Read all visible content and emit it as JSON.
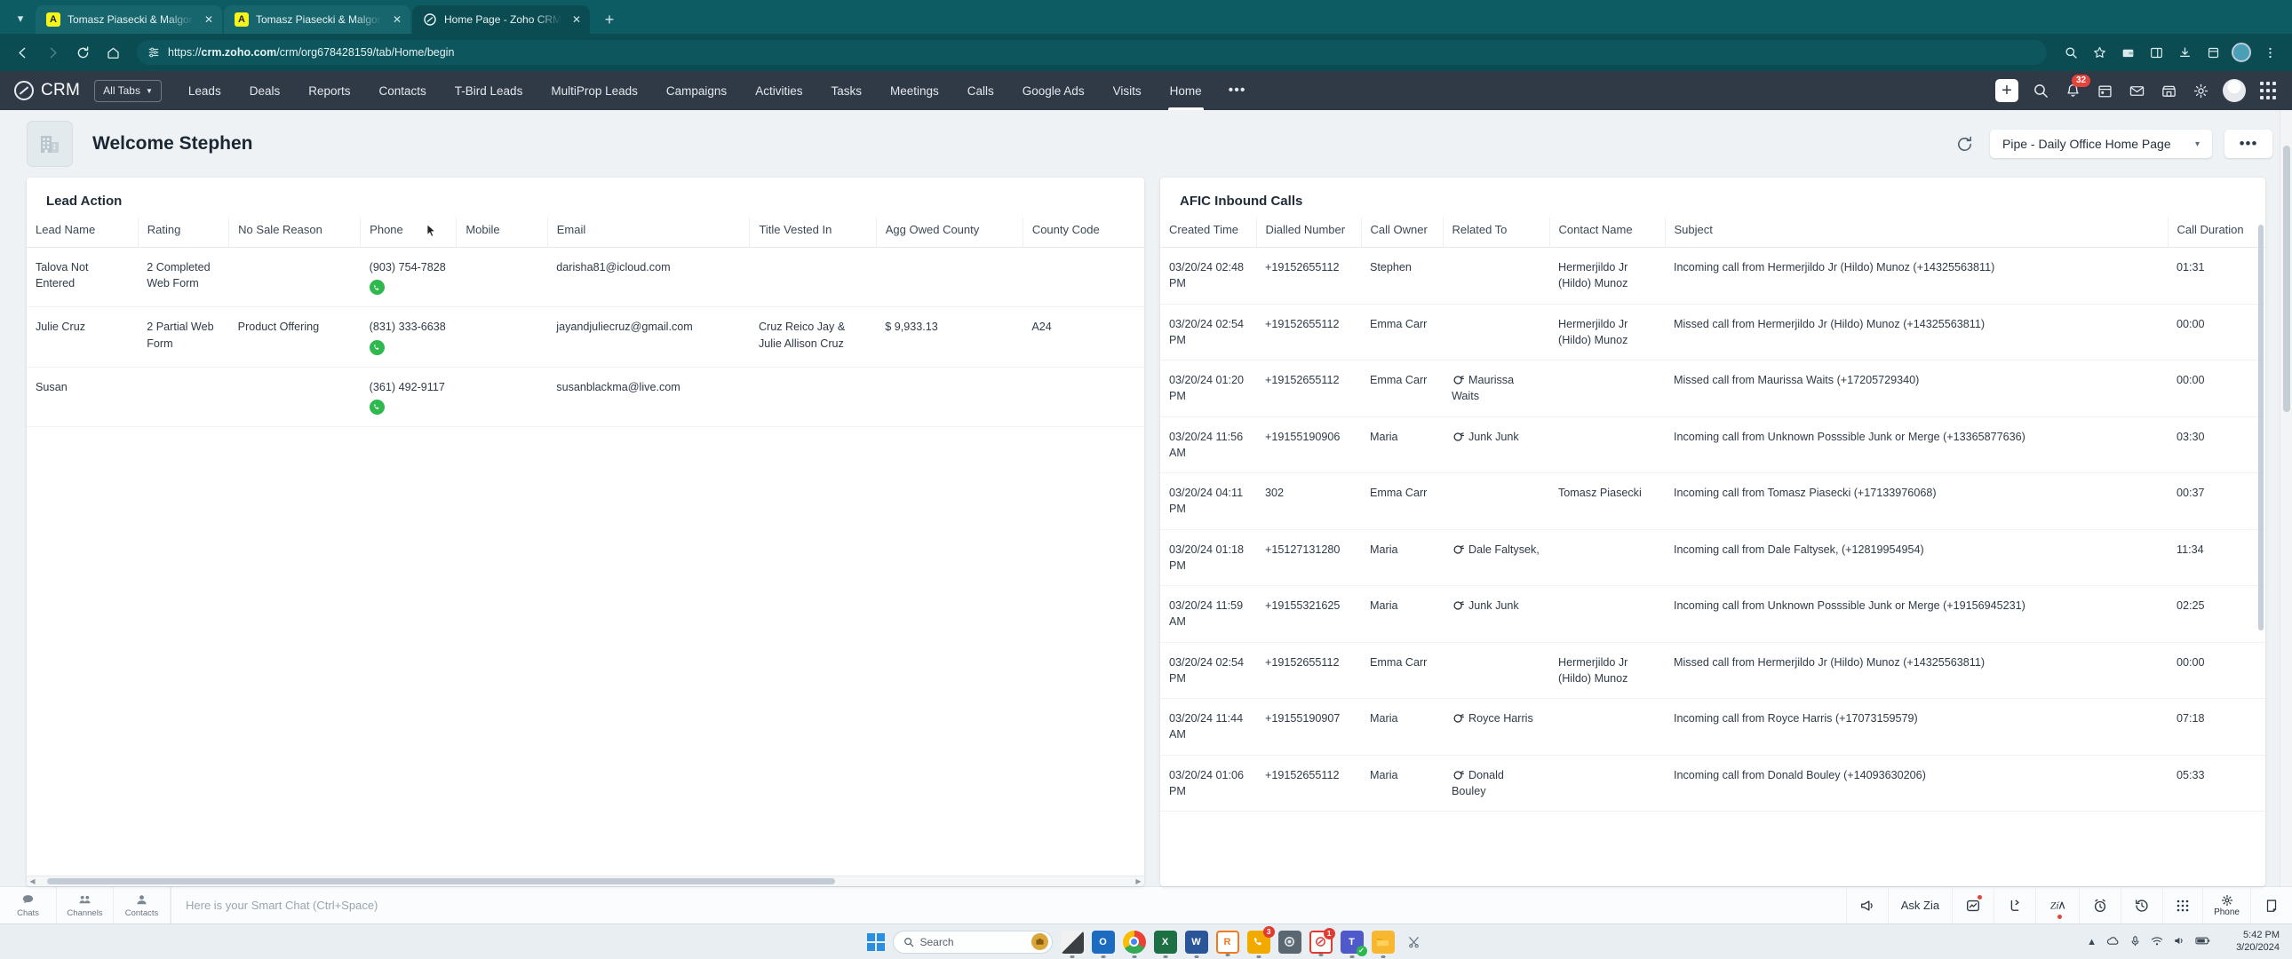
{
  "browser": {
    "tabs": [
      {
        "title": "Tomasz Piasecki & Malgorzata",
        "favicon": "acrobat-icon",
        "active": false
      },
      {
        "title": "Tomasz Piasecki & Malgorzata",
        "favicon": "acrobat-icon",
        "active": false
      },
      {
        "title": "Home Page - Zoho CRM",
        "favicon": "zoho-icon",
        "active": true
      }
    ],
    "new_tab_label": "+",
    "url_scheme": "https://",
    "url_host": "crm.zoho.com",
    "url_path": "/crm/org678428159/tab/Home/begin",
    "back_label": "←",
    "forward_label": "→",
    "reload_label": "⟳",
    "home_label": "⌂"
  },
  "crm_header": {
    "logo_text": "CRM",
    "all_tabs_label": "All Tabs",
    "nav": [
      {
        "label": "Leads",
        "active": false
      },
      {
        "label": "Deals",
        "active": false
      },
      {
        "label": "Reports",
        "active": false
      },
      {
        "label": "Contacts",
        "active": false
      },
      {
        "label": "T-Bird Leads",
        "active": false
      },
      {
        "label": "MultiProp Leads",
        "active": false
      },
      {
        "label": "Campaigns",
        "active": false
      },
      {
        "label": "Activities",
        "active": false
      },
      {
        "label": "Tasks",
        "active": false
      },
      {
        "label": "Meetings",
        "active": false
      },
      {
        "label": "Calls",
        "active": false
      },
      {
        "label": "Google Ads",
        "active": false
      },
      {
        "label": "Visits",
        "active": false
      },
      {
        "label": "Home",
        "active": true
      }
    ],
    "more_label": "•••",
    "notification_count": "32",
    "add_label": "+"
  },
  "welcome": {
    "title": "Welcome Stephen",
    "view_name": "Pipe - Daily Office Home Page",
    "view_caret": "▾",
    "more_label": "•••"
  },
  "lead_action": {
    "title": "Lead Action",
    "columns": [
      "Lead Name",
      "Rating",
      "No Sale Reason",
      "Phone",
      "Mobile",
      "Email",
      "Title Vested In",
      "Agg Owed County",
      "County Code"
    ],
    "rows": [
      {
        "lead_name": "Talova Not Entered",
        "rating": "2 Completed Web Form",
        "no_sale_reason": "",
        "phone": "(903) 754-7828",
        "has_phone_call": true,
        "mobile": "",
        "email": "darisha81@icloud.com",
        "title_vested_in": "",
        "agg_owed_county": "",
        "county_code": ""
      },
      {
        "lead_name": "Julie Cruz",
        "rating": "2 Partial Web Form",
        "no_sale_reason": "Product Offering",
        "phone": "(831) 333-6638",
        "has_phone_call": true,
        "mobile": "",
        "email": "jayandjuliecruz@gmail.com",
        "title_vested_in": "Cruz Reico Jay & Julie Allison Cruz",
        "agg_owed_county": "$ 9,933.13",
        "county_code": "A24"
      },
      {
        "lead_name": "Susan",
        "rating": "",
        "no_sale_reason": "",
        "phone": "(361) 492-9117",
        "has_phone_call": true,
        "mobile": "",
        "email": "susanblackma@live.com",
        "title_vested_in": "",
        "agg_owed_county": "",
        "county_code": ""
      }
    ]
  },
  "afic_calls": {
    "title": "AFIC Inbound Calls",
    "columns": [
      "Created Time",
      "Dialled Number",
      "Call Owner",
      "Related To",
      "Contact Name",
      "Subject",
      "Call Duration"
    ],
    "rows": [
      {
        "created_time": "03/20/24 02:48 PM",
        "dialled_number": "+19152655112",
        "call_owner": "Stephen",
        "related_to": "",
        "related_icon": false,
        "contact_name": "Hermerjildo Jr (Hildo) Munoz",
        "subject": "Incoming call from Hermerjildo Jr (Hildo) Munoz (+14325563811)",
        "call_duration": "01:31"
      },
      {
        "created_time": "03/20/24 02:54 PM",
        "dialled_number": "+19152655112",
        "call_owner": "Emma Carr",
        "related_to": "",
        "related_icon": false,
        "contact_name": "Hermerjildo Jr (Hildo) Munoz",
        "subject": "Missed call from Hermerjildo Jr (Hildo) Munoz (+14325563811)",
        "call_duration": "00:00"
      },
      {
        "created_time": "03/20/24 01:20 PM",
        "dialled_number": "+19152655112",
        "call_owner": "Emma Carr",
        "related_to": "Maurissa Waits",
        "related_icon": true,
        "contact_name": "",
        "subject": "Missed call from Maurissa Waits (+17205729340)",
        "call_duration": "00:00"
      },
      {
        "created_time": "03/20/24 11:56 AM",
        "dialled_number": "+19155190906",
        "call_owner": "Maria",
        "related_to": "Junk Junk",
        "related_icon": true,
        "contact_name": "",
        "subject": "Incoming call from Unknown Posssible Junk or Merge (+13365877636)",
        "call_duration": "03:30"
      },
      {
        "created_time": "03/20/24 04:11 PM",
        "dialled_number": "302",
        "call_owner": "Emma Carr",
        "related_to": "",
        "related_icon": false,
        "contact_name": "Tomasz Piasecki",
        "subject": "Incoming call from Tomasz Piasecki (+17133976068)",
        "call_duration": "00:37"
      },
      {
        "created_time": "03/20/24 01:18 PM",
        "dialled_number": "+15127131280",
        "call_owner": "Maria",
        "related_to": "Dale Faltysek,",
        "related_icon": true,
        "contact_name": "",
        "subject": "Incoming call from Dale Faltysek, (+12819954954)",
        "call_duration": "11:34"
      },
      {
        "created_time": "03/20/24 11:59 AM",
        "dialled_number": "+19155321625",
        "call_owner": "Maria",
        "related_to": "Junk Junk",
        "related_icon": true,
        "contact_name": "",
        "subject": "Incoming call from Unknown Posssible Junk or Merge (+19156945231)",
        "call_duration": "02:25"
      },
      {
        "created_time": "03/20/24 02:54 PM",
        "dialled_number": "+19152655112",
        "call_owner": "Emma Carr",
        "related_to": "",
        "related_icon": false,
        "contact_name": "Hermerjildo Jr (Hildo) Munoz",
        "subject": "Missed call from Hermerjildo Jr (Hildo) Munoz (+14325563811)",
        "call_duration": "00:00"
      },
      {
        "created_time": "03/20/24 11:44 AM",
        "dialled_number": "+19155190907",
        "call_owner": "Maria",
        "related_to": "Royce Harris",
        "related_icon": true,
        "contact_name": "",
        "subject": "Incoming call from Royce Harris (+17073159579)",
        "call_duration": "07:18"
      },
      {
        "created_time": "03/20/24 01:06 PM",
        "dialled_number": "+19152655112",
        "call_owner": "Maria",
        "related_to": "Donald Bouley",
        "related_icon": true,
        "contact_name": "",
        "subject": "Incoming call from Donald Bouley (+14093630206)",
        "call_duration": "05:33"
      }
    ]
  },
  "chatbar": {
    "tabs": [
      {
        "label": "Chats",
        "icon": "chat-bubble-icon"
      },
      {
        "label": "Channels",
        "icon": "people-icon"
      },
      {
        "label": "Contacts",
        "icon": "person-icon"
      }
    ],
    "placeholder": "Here is your Smart Chat (Ctrl+Space)",
    "tools": [
      {
        "label": "",
        "icon": "megaphone-icon"
      },
      {
        "label": "Ask Zia",
        "icon": ""
      },
      {
        "label": "",
        "icon": "analytics-icon"
      },
      {
        "label": "",
        "icon": "share-icon"
      },
      {
        "label": "",
        "icon": "zia-icon"
      },
      {
        "label": "",
        "icon": "alarm-icon"
      },
      {
        "label": "",
        "icon": "history-icon"
      },
      {
        "label": "",
        "icon": "grid-icon"
      },
      {
        "label": "Phone",
        "icon": "gear-icon"
      },
      {
        "label": "",
        "icon": "notes-icon"
      }
    ]
  },
  "taskbar": {
    "search_placeholder": "Search",
    "apps": [
      {
        "name": "task-view",
        "label": "",
        "color": "#3a3f44",
        "count": ""
      },
      {
        "name": "outlook",
        "label": "O",
        "color": "#1b6bc0",
        "count": ""
      },
      {
        "name": "chrome",
        "label": "",
        "color": "#e8e8e8",
        "count": ""
      },
      {
        "name": "excel",
        "label": "X",
        "color": "#1d7044",
        "count": ""
      },
      {
        "name": "word",
        "label": "W",
        "color": "#2a5699",
        "count": ""
      },
      {
        "name": "ringcentral",
        "label": "R",
        "color": "#f47a20",
        "count": ""
      },
      {
        "name": "phone-app",
        "label": "",
        "color": "#f2a900",
        "count": "3"
      },
      {
        "name": "settings-app",
        "label": "",
        "color": "#5b6770",
        "count": ""
      },
      {
        "name": "zoho-assist",
        "label": "",
        "color": "#e03b30",
        "count": "1"
      },
      {
        "name": "teams",
        "label": "T",
        "color": "#5059c9",
        "count": ""
      },
      {
        "name": "file-explorer",
        "label": "",
        "color": "#f7b731",
        "count": ""
      },
      {
        "name": "snip-tool",
        "label": "",
        "color": "#6f7a85",
        "count": ""
      }
    ],
    "time": "5:42 PM",
    "date": "3/20/2024"
  }
}
